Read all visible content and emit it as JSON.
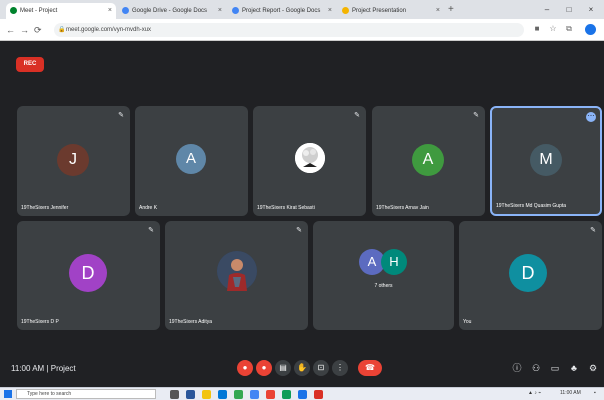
{
  "browser": {
    "tabs": [
      {
        "label": "Meet - Project",
        "active": true,
        "favicon_color": "#00832d"
      },
      {
        "label": "Google Drive - Google Docs",
        "active": false,
        "favicon_color": "#4285f4"
      },
      {
        "label": "Project Report - Google Docs",
        "active": false,
        "favicon_color": "#4285f4"
      },
      {
        "label": "Project Presentation",
        "active": false,
        "favicon_color": "#f4b400"
      }
    ],
    "new_tab": "+",
    "url": "meet.google.com/vyn-mvdh-xux",
    "window_controls": {
      "minimize": "–",
      "maximize": "□",
      "close": "×"
    }
  },
  "meet": {
    "rec_label": "REC",
    "participants": [
      {
        "name": "19TheSixers Jennifer",
        "initial": "J",
        "color": "#6b3a2e"
      },
      {
        "name": "Andre K",
        "initial": "A",
        "color": "#5f87a8"
      },
      {
        "name": "19TheSixers Kirat Sebasti",
        "initial": "",
        "color": "#ffffff"
      },
      {
        "name": "19TheSixers Arnav Jain",
        "initial": "A",
        "color": "#3f9a3f"
      },
      {
        "name": "19TheSixers Md Quasim Gupta",
        "initial": "M",
        "color": "#455a64"
      },
      {
        "name": "19TheSixers D P",
        "initial": "D",
        "color": "#a142c6"
      },
      {
        "name": "19TheSixers Aditya",
        "initial": "",
        "color": "#2c3b52"
      },
      {
        "name": "7 others",
        "initial": "",
        "color": "#3c4043"
      },
      {
        "name": "You",
        "initial": "D",
        "color": "#0f8fa0"
      }
    ],
    "others_avatars": [
      {
        "initial": "A",
        "color": "#5c6bc0"
      },
      {
        "initial": "H",
        "color": "#00897b"
      }
    ],
    "time_meeting": "11:00 AM  |  Project"
  },
  "taskbar": {
    "search_placeholder": "Type here to search",
    "clock": "11:00 AM"
  }
}
